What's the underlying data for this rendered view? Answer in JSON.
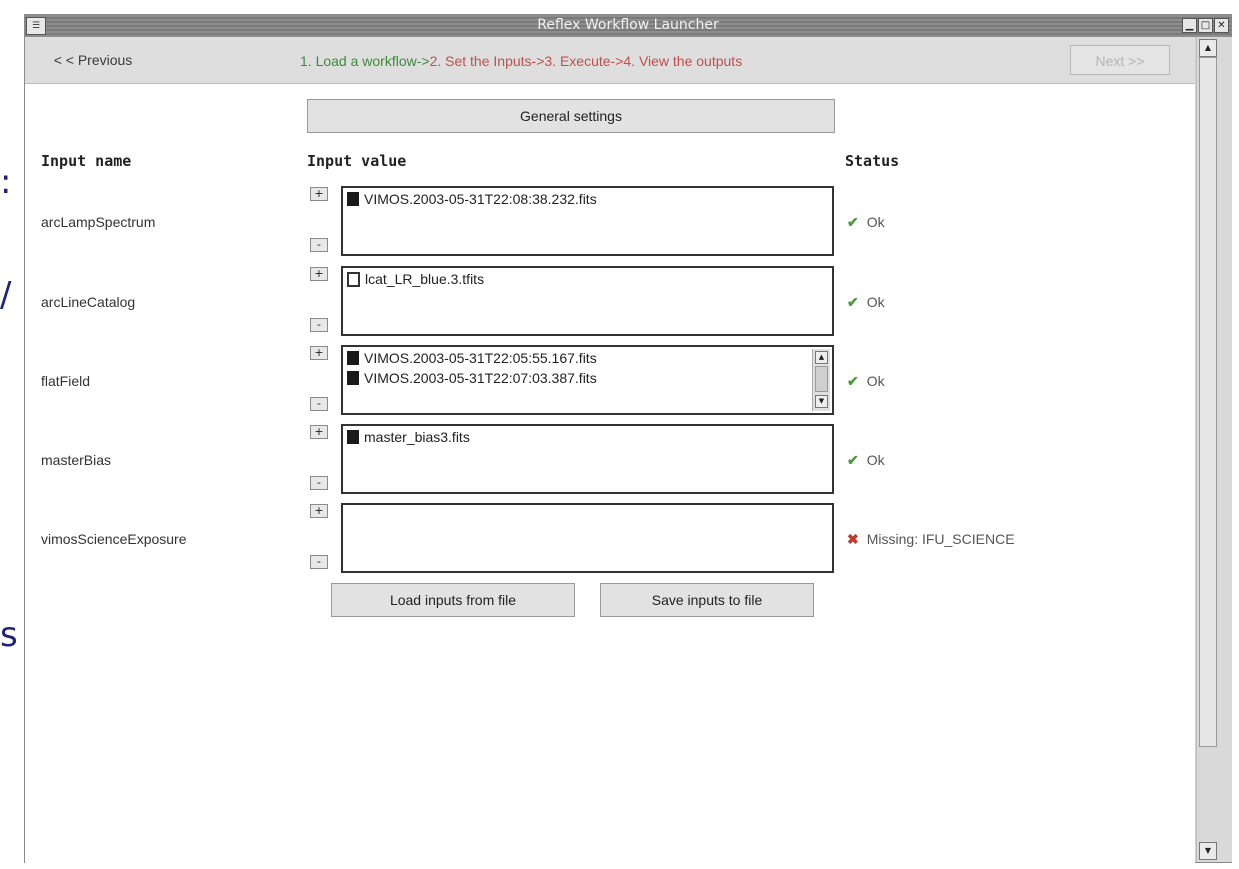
{
  "window": {
    "title": "Reflex Workflow Launcher",
    "app_icon": "app-icon",
    "controls": [
      "minimize-icon",
      "maximize-icon",
      "close-icon"
    ]
  },
  "slide_fragments": [
    ":",
    "/",
    "s"
  ],
  "nav": {
    "prev_label": "< < Previous",
    "next_label": "Next >>",
    "steps": {
      "step1": "1. Load a workflow->",
      "step2": "2. Set the Inputs->",
      "step3": "3. Execute->",
      "step4": "4. View the outputs"
    }
  },
  "general_settings_label": "General settings",
  "headers": {
    "input_name": "Input name",
    "input_value": "Input value",
    "status": "Status"
  },
  "inputs": [
    {
      "name": "arcLampSpectrum",
      "files": [
        "VIMOS.2003-05-31T22:08:38.232.fits"
      ],
      "status": "Ok"
    },
    {
      "name": "arcLineCatalog",
      "files": [
        "lcat_LR_blue.3.tfits"
      ],
      "status": "Ok"
    },
    {
      "name": "flatField",
      "files": [
        "VIMOS.2003-05-31T22:05:55.167.fits",
        "VIMOS.2003-05-31T22:07:03.387.fits"
      ],
      "status": "Ok"
    },
    {
      "name": "masterBias",
      "files": [
        "master_bias3.fits"
      ],
      "status": "Ok"
    },
    {
      "name": "vimosScienceExposure",
      "files": [],
      "status": "Missing: IFU_SCIENCE"
    }
  ],
  "buttons": {
    "add": "+",
    "remove": "-",
    "load_inputs": "Load inputs from file",
    "save_inputs": "Save inputs to file"
  },
  "colors": {
    "step_done": "#3d8a3d",
    "step_todo": "#c0504d",
    "ok": "#4a9a3a",
    "missing": "#c0392b"
  }
}
